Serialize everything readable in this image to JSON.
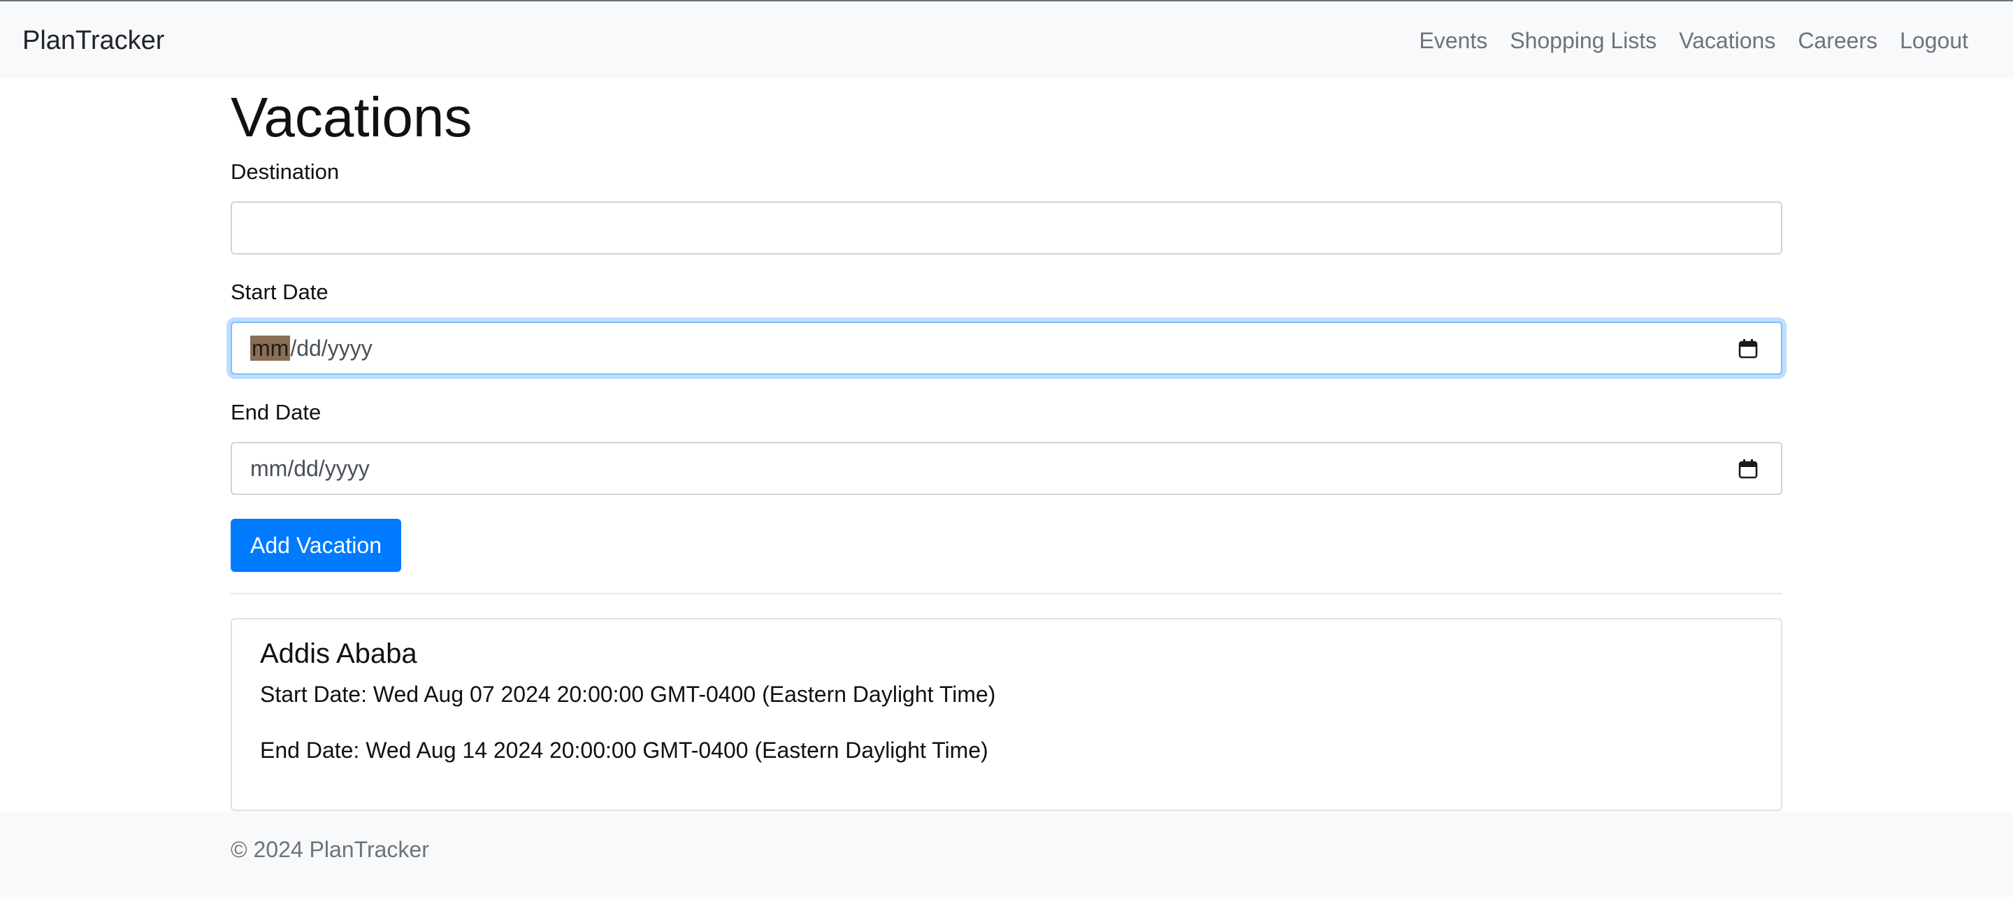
{
  "navbar": {
    "brand": "PlanTracker",
    "links": [
      "Events",
      "Shopping Lists",
      "Vacations",
      "Careers",
      "Logout"
    ]
  },
  "page": {
    "title": "Vacations"
  },
  "form": {
    "destination_label": "Destination",
    "destination_value": "",
    "start_date_label": "Start Date",
    "start_date_month_placeholder": "mm",
    "start_date_rest_placeholder": "/dd/yyyy",
    "end_date_label": "End Date",
    "end_date_placeholder": "mm/dd/yyyy",
    "submit_label": "Add Vacation"
  },
  "vacations": [
    {
      "destination": "Addis Ababa",
      "start": "Start Date: Wed Aug 07 2024 20:00:00 GMT-0400 (Eastern Daylight Time)",
      "end": "End Date: Wed Aug 14 2024 20:00:00 GMT-0400 (Eastern Daylight Time)"
    }
  ],
  "footer": {
    "text": "© 2024 PlanTracker"
  },
  "colors": {
    "primary": "#007bff",
    "navbar_bg": "#f8f9fa",
    "focus_border": "#80bdff"
  },
  "icons": {
    "calendar": "calendar-icon"
  }
}
